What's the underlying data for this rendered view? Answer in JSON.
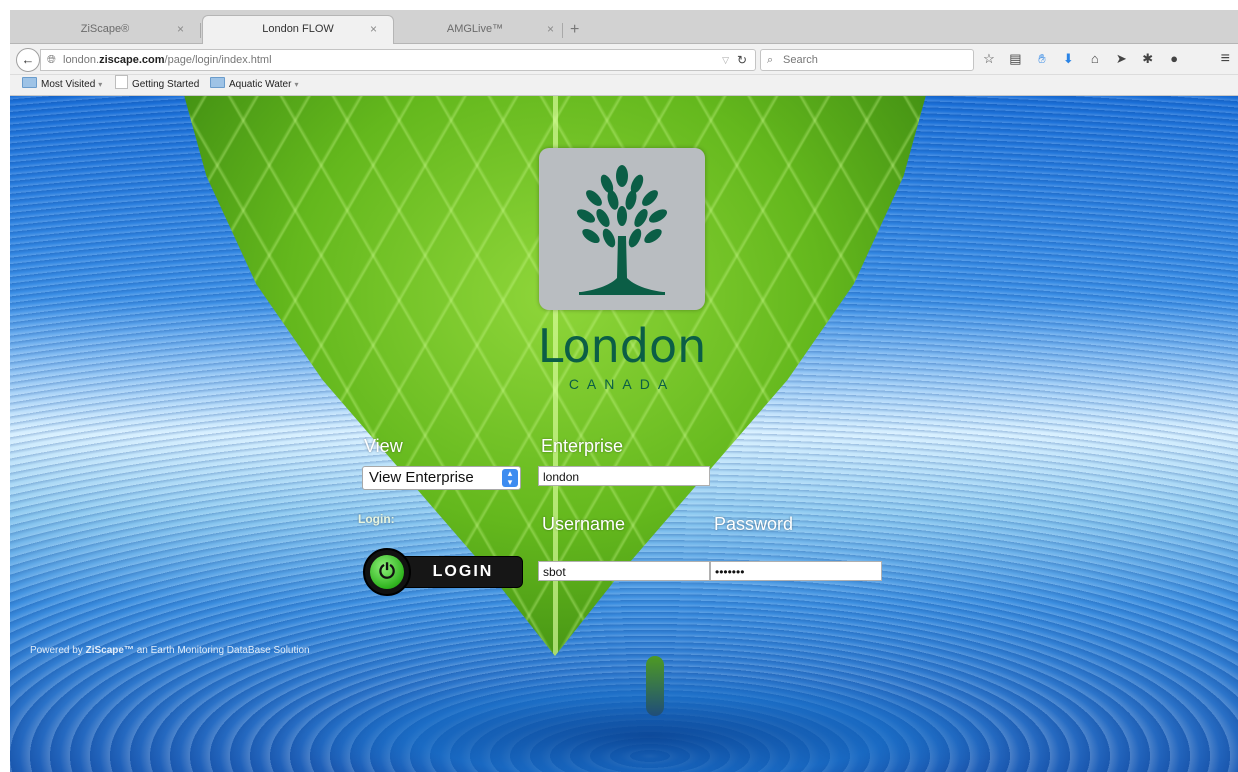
{
  "tabs": [
    {
      "label": "ZiScape®",
      "active": false
    },
    {
      "label": "London FLOW",
      "active": true
    },
    {
      "label": "AMGLive™",
      "active": false
    }
  ],
  "new_tab_symbol": "+",
  "tab_close_symbol": "×",
  "address": {
    "url_prefix": "london.",
    "url_domain": "ziscape.com",
    "url_path": "/page/login/index.html"
  },
  "search": {
    "placeholder": "Search"
  },
  "bookmarks": [
    {
      "label": "Most Visited",
      "has_caret": true
    },
    {
      "label": "Getting Started",
      "has_caret": false
    },
    {
      "label": "Aquatic Water",
      "has_caret": true
    }
  ],
  "brand": {
    "name": "London",
    "subtitle": "CANADA",
    "primary_color": "#0b5e46"
  },
  "form": {
    "view_label": "View",
    "view_selected": "View Enterprise",
    "enterprise_label": "Enterprise",
    "enterprise_value": "london",
    "login_caption": "Login:",
    "username_label": "Username",
    "username_value": "sbot",
    "password_label": "Password",
    "password_value": "•••••••",
    "login_button": "LOGIN"
  },
  "footer": {
    "powered_prefix": "Powered by ",
    "powered_brand": "ZiScape™",
    "powered_suffix": " an Earth Monitoring DataBase Solution"
  }
}
